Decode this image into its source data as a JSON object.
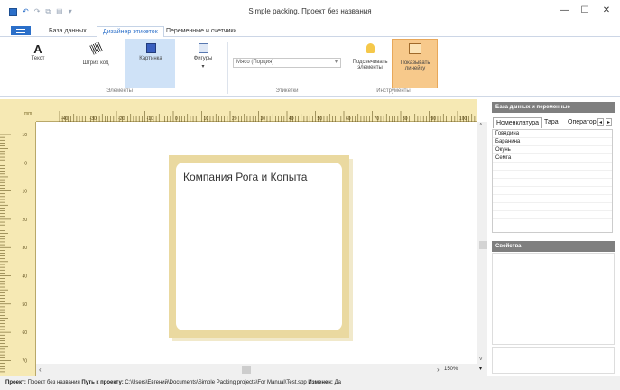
{
  "window": {
    "title": "Simple packing. Проект без названия"
  },
  "quick_access": [
    "save-icon",
    "undo-icon",
    "redo-icon",
    "copy-icon",
    "paste-icon",
    "dropdown-icon"
  ],
  "window_controls": {
    "minimize": "—",
    "maximize": "☐",
    "close": "✕"
  },
  "tabs": [
    {
      "label": "База данных",
      "active": false
    },
    {
      "label": "Дизайнер этикеток",
      "active": true
    },
    {
      "label": "Переменные и счетчики",
      "active": false
    }
  ],
  "ribbon": {
    "elements": {
      "group_label": "Элементы",
      "text": "Текст",
      "barcode": "Штрих код",
      "picture": "Картинка",
      "shapes": "Фигуры"
    },
    "labels": {
      "group_label": "Этикетки",
      "select_value": "Мясо (Порция)"
    },
    "tools": {
      "group_label": "Инструменты",
      "highlight": "Подсвечивать элементы",
      "show_ruler": "Показывать линейку"
    }
  },
  "ruler": {
    "unit": "mm",
    "h_ticks": [
      "-40",
      "-30",
      "-20",
      "-10",
      "0",
      "10",
      "20",
      "30",
      "40",
      "50",
      "60",
      "70",
      "80",
      "90",
      "100"
    ],
    "v_ticks": [
      "-10",
      "0",
      "10",
      "20",
      "30",
      "40",
      "50",
      "60",
      "70"
    ]
  },
  "canvas": {
    "label_text": "Компания Рога и Копыта",
    "zoom": "150%"
  },
  "right_panel": {
    "db_header": "База данных и переменные",
    "tabs": [
      {
        "label": "Номенклатура",
        "active": true
      },
      {
        "label": "Тара",
        "active": false
      },
      {
        "label": "Оператор",
        "active": false
      }
    ],
    "items": [
      "Говядина",
      "Баранина",
      "Окунь",
      "Семга"
    ],
    "props_header": "Свойства"
  },
  "status": {
    "project_label": "Проект:",
    "project_value": "Проект без названия",
    "path_label": "Путь к проекту:",
    "path_value": "C:\\Users\\Евгений\\Documents\\Simple Packing projects\\For Manual\\Test.spp",
    "changed_label": "Изменен:",
    "changed_value": "Да"
  },
  "colors": {
    "accent": "#2b6fc9",
    "ruler": "#f6e9b4",
    "label_border": "#ead9a0",
    "active_tool": "#f7c98b"
  }
}
